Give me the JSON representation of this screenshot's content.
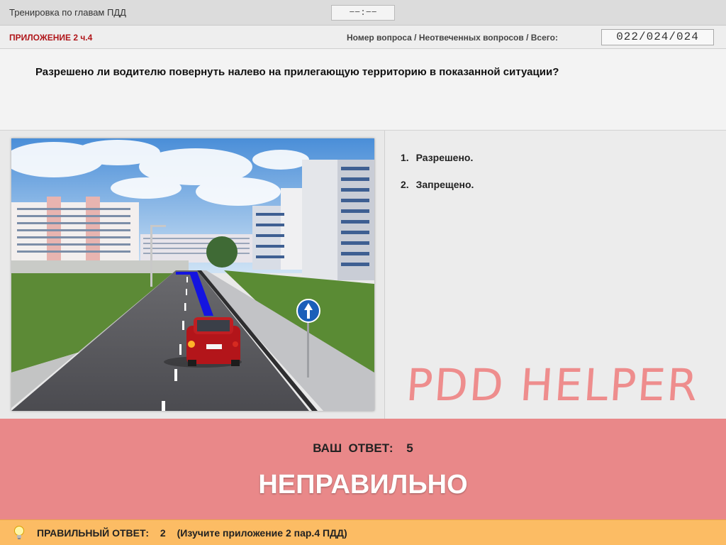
{
  "header": {
    "title": "Тренировка по главам ПДД",
    "timer": "−−:−−"
  },
  "info": {
    "chapter": "ПРИЛОЖЕНИЕ 2 ч.4",
    "counter_label": "Номер вопроса / Неотвеченных вопросов / Всего:",
    "counter_value": "022/024/024"
  },
  "question": {
    "text": "Разрешено ли водителю повернуть налево на прилегающую территорию в показанной ситуации?"
  },
  "answers": [
    {
      "number": "1.",
      "label": "Разрешено."
    },
    {
      "number": "2.",
      "label": "Запрещено."
    }
  ],
  "watermark": "PDD HELPER",
  "result": {
    "your_answer_label": "ВАШ  ОТВЕТ:",
    "your_answer_value": "5",
    "verdict": "НЕПРАВИЛЬНО"
  },
  "correct": {
    "label": "ПРАВИЛЬНЫЙ ОТВЕТ:",
    "value": "2",
    "hint": "(Изучите приложение 2 пар.4 ПДД)"
  },
  "colors": {
    "result_band": "#e98889",
    "correct_bar": "#fcbc64",
    "chapter_red": "#b0161a",
    "route_blue": "#1414e0"
  },
  "icons": [
    "light-bulb-icon",
    "one-way-sign-icon"
  ]
}
